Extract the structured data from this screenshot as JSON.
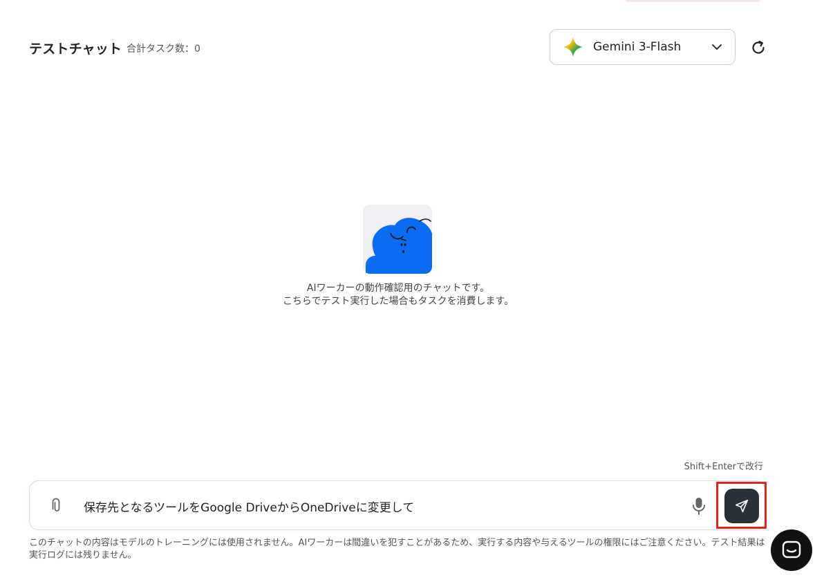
{
  "header": {
    "title": "テストチャット",
    "task_count": "合計タスク数：0"
  },
  "model_selector": {
    "selected": "Gemini 3-Flash",
    "icon": "gemini-sparkle-icon"
  },
  "refresh": {
    "icon": "refresh-icon"
  },
  "intro": {
    "line1": "AIワーカーの動作確認用のチャットです。",
    "line2": "こちらでテスト実行した場合もタスクを消費します。"
  },
  "composer": {
    "hint": "Shift+Enterで改行",
    "value": "保存先となるツールをGoogle DriveからOneDriveに変更して",
    "attach_icon": "paperclip-icon",
    "mic_icon": "microphone-icon",
    "send_icon": "send-icon"
  },
  "disclaimer": "このチャットの内容はモデルのトレーニングには使用されません。AIワーカーは間違いを犯すことがあるため、実行する内容や与えるツールの権限にはご注意ください。テスト結果は実行ログには残りません。",
  "colors": {
    "send_button": "#2b3138",
    "highlight": "#e3241b",
    "mascot_blue": "#0a6cf2",
    "launcher": "#111111"
  }
}
